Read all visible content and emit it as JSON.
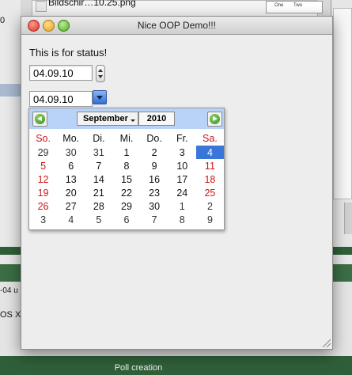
{
  "background": {
    "file_label": "Bildschir…10.25.png",
    "thumb_labels": [
      "One",
      "Two"
    ],
    "left_fragments": [
      "0",
      "-04 u",
      "OS X"
    ],
    "poll_label": "Poll creation",
    "colors": {
      "green_band": "#2f5f38"
    }
  },
  "window": {
    "title": "Nice OOP Demo!!!",
    "status_text": "This is for status!",
    "date_stepper_value": "04.09.10",
    "date_combo_value": "04.09.10"
  },
  "calendar": {
    "month": "September",
    "year": "2010",
    "weekday_headers": [
      "So.",
      "Mo.",
      "Di.",
      "Mi.",
      "Do.",
      "Fr.",
      "Sa."
    ],
    "weeks": [
      [
        "29",
        "30",
        "31",
        "1",
        "2",
        "3",
        "4"
      ],
      [
        "5",
        "6",
        "7",
        "8",
        "9",
        "10",
        "11"
      ],
      [
        "12",
        "13",
        "14",
        "15",
        "16",
        "17",
        "18"
      ],
      [
        "19",
        "20",
        "21",
        "22",
        "23",
        "24",
        "25"
      ],
      [
        "26",
        "27",
        "28",
        "29",
        "30",
        "1",
        "2"
      ],
      [
        "3",
        "4",
        "5",
        "6",
        "7",
        "8",
        "9"
      ]
    ],
    "selected_day": "4",
    "colors": {
      "header_bg": "#b8d2f8",
      "selected_bg": "#3a76d8",
      "weekend": "#d01414"
    }
  }
}
